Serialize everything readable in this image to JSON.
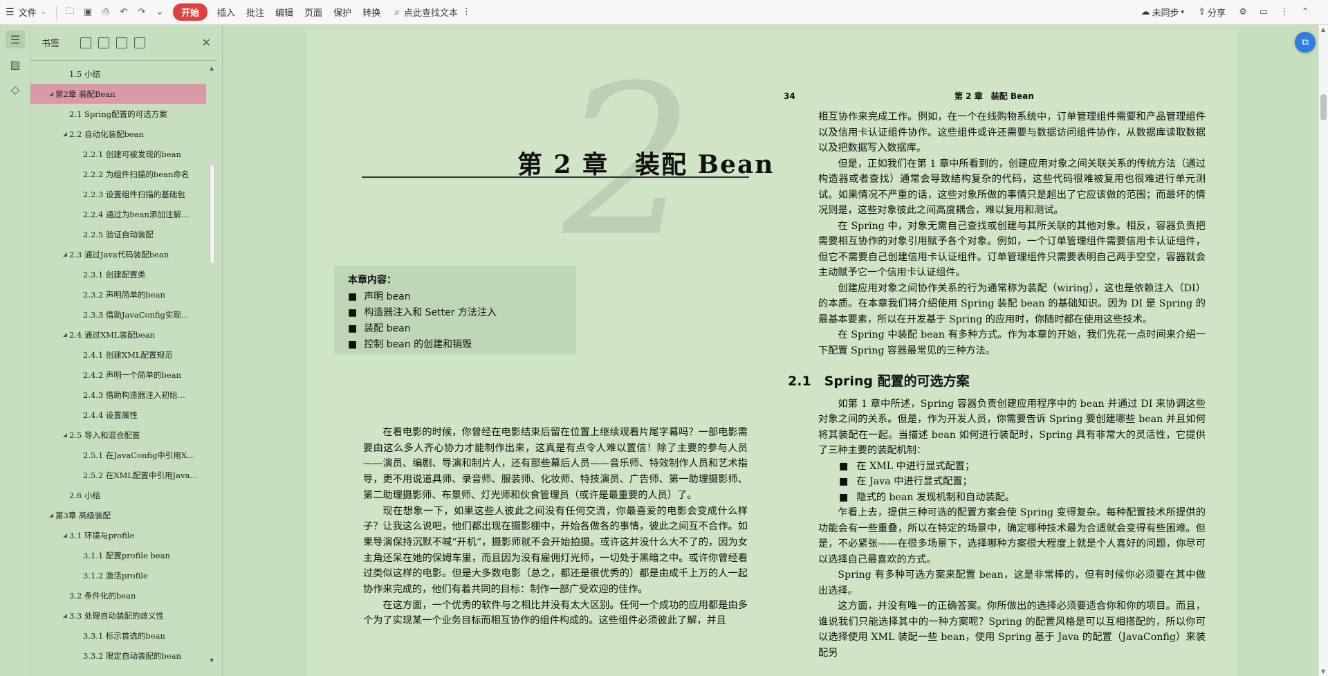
{
  "toolbar": {
    "file": "文件",
    "start": "开始",
    "tabs": [
      "插入",
      "批注",
      "编辑",
      "页面",
      "保护",
      "转换"
    ],
    "search_placeholder": "点此查找文本",
    "sync": "未同步",
    "share": "分享"
  },
  "sidebar": {
    "title": "书签",
    "items": [
      {
        "level": 2,
        "label": "1.5 小结",
        "toggle": ""
      },
      {
        "level": 1,
        "label": "第2章 装配Bean",
        "toggle": "◢",
        "selected": true
      },
      {
        "level": 2,
        "label": "2.1 Spring配置的可选方案",
        "toggle": ""
      },
      {
        "level": 2,
        "label": "2.2 自动化装配bean",
        "toggle": "◢"
      },
      {
        "level": 3,
        "label": "2.2.1 创建可被发现的bean",
        "toggle": ""
      },
      {
        "level": 3,
        "label": "2.2.2 为组件扫描的bean命名",
        "toggle": ""
      },
      {
        "level": 3,
        "label": "2.2.3 设置组件扫描的基础包",
        "toggle": ""
      },
      {
        "level": 3,
        "label": "2.2.4 通过为bean添加注解…",
        "toggle": ""
      },
      {
        "level": 3,
        "label": "2.2.5 验证自动装配",
        "toggle": ""
      },
      {
        "level": 2,
        "label": "2.3 通过Java代码装配bean",
        "toggle": "◢"
      },
      {
        "level": 3,
        "label": "2.3.1 创建配置类",
        "toggle": ""
      },
      {
        "level": 3,
        "label": "2.3.2 声明简单的bean",
        "toggle": ""
      },
      {
        "level": 3,
        "label": "2.3.3 借助JavaConfig实现…",
        "toggle": ""
      },
      {
        "level": 2,
        "label": "2.4 通过XML装配bean",
        "toggle": "◢"
      },
      {
        "level": 3,
        "label": "2.4.1 创建XML配置规范",
        "toggle": ""
      },
      {
        "level": 3,
        "label": "2.4.2 声明一个简单的bean",
        "toggle": ""
      },
      {
        "level": 3,
        "label": "2.4.3 借助构造器注入初始…",
        "toggle": ""
      },
      {
        "level": 3,
        "label": "2.4.4 设置属性",
        "toggle": ""
      },
      {
        "level": 2,
        "label": "2.5 导入和混合配置",
        "toggle": "◢"
      },
      {
        "level": 3,
        "label": "2.5.1 在JavaConfig中引用X…",
        "toggle": ""
      },
      {
        "level": 3,
        "label": "2.5.2 在XML配置中引用Java…",
        "toggle": ""
      },
      {
        "level": 2,
        "label": "2.6 小结",
        "toggle": ""
      },
      {
        "level": 1,
        "label": "第3章 高级装配",
        "toggle": "◢"
      },
      {
        "level": 2,
        "label": "3.1 环境与profile",
        "toggle": "◢"
      },
      {
        "level": 3,
        "label": "3.1.1 配置profile bean",
        "toggle": ""
      },
      {
        "level": 3,
        "label": "3.1.2 激活profile",
        "toggle": ""
      },
      {
        "level": 2,
        "label": "3.2 条件化的bean",
        "toggle": ""
      },
      {
        "level": 2,
        "label": "3.3 处理自动装配的歧义性",
        "toggle": "◢"
      },
      {
        "level": 3,
        "label": "3.3.1 标示首选的bean",
        "toggle": ""
      },
      {
        "level": 3,
        "label": "3.3.2 限定自动装配的bean",
        "toggle": ""
      }
    ]
  },
  "page_left": {
    "big_numeral": "2",
    "chapter_title": "第 2 章　装配 Bean",
    "contents_title": "本章内容：",
    "contents": [
      "声明 bean",
      "构造器注入和 Setter 方法注入",
      "装配 bean",
      "控制 bean 的创建和销毁"
    ],
    "paragraphs": [
      "在看电影的时候，你曾经在电影结束后留在位置上继续观看片尾字幕吗？一部电影需要由这么多人齐心协力才能制作出来，这真是有点令人难以置信！除了主要的参与人员——演员、编剧、导演和制片人，还有那些幕后人员——音乐师、特效制作人员和艺术指导，更不用说道具师、录音师、服装师、化妆师、特技演员、广告师、第一助理摄影师、第二助理摄影师、布景师、灯光师和伙食管理员（或许是最重要的人员）了。",
      "现在想象一下，如果这些人彼此之间没有任何交流，你最喜爱的电影会变成什么样子？让我这么说吧，他们都出现在摄影棚中，开始各做各的事情，彼此之间互不合作。如果导演保持沉默不喊“开机”，摄影师就不会开始拍摄。或许这并没什么大不了的，因为女主角还呆在她的保姆车里，而且因为没有雇佣灯光师，一切处于黑暗之中。或许你曾经看过类似这样的电影。但是大多数电影（总之，都还是很优秀的）都是由成千上万的人一起协作来完成的，他们有着共同的目标：制作一部广受欢迎的佳作。",
      "在这方面，一个优秀的软件与之相比并没有太大区别。任何一个成功的应用都是由多个为了实现某一个业务目标而相互协作的组件构成的。这些组件必须彼此了解，并且"
    ]
  },
  "page_right": {
    "page_number": "34",
    "running_head": "第 2 章　装配 Bean",
    "p1": [
      "相互协作来完成工作。例如，在一个在线购物系统中，订单管理组件需要和产品管理组件以及信用卡认证组件协作。这些组件或许还需要与数据访问组件协作，从数据库读取数据以及把数据写入数据库。",
      "但是，正如我们在第 1 章中所看到的，创建应用对象之间关联关系的传统方法（通过构造器或者查找）通常会导致结构复杂的代码，这些代码很难被复用也很难进行单元测试。如果情况不严重的话，这些对象所做的事情只是超出了它应该做的范围；而最坏的情况则是，这些对象彼此之间高度耦合，难以复用和测试。",
      "在 Spring 中，对象无需自己查找或创建与其所关联的其他对象。相反，容器负责把需要相互协作的对象引用赋予各个对象。例如，一个订单管理组件需要信用卡认证组件，但它不需要自己创建信用卡认证组件。订单管理组件只需要表明自己两手空空，容器就会主动赋予它一个信用卡认证组件。",
      "创建应用对象之间协作关系的行为通常称为装配（wiring），这也是依赖注入（DI）的本质。在本章我们将介绍使用 Spring 装配 bean 的基础知识。因为 DI 是 Spring 的最基本要素，所以在开发基于 Spring 的应用时，你随时都在使用这些技术。",
      "在 Spring 中装配 bean 有多种方式。作为本章的开始，我们先花一点时间来介绍一下配置 Spring 容器最常见的三种方法。"
    ],
    "section_heading": "2.1　Spring 配置的可选方案",
    "p2": "如第 1 章中所述，Spring 容器负责创建应用程序中的 bean 并通过 DI 来协调这些对象之间的关系。但是，作为开发人员，你需要告诉 Spring 要创建哪些 bean 并且如何将其装配在一起。当描述 bean 如何进行装配时，Spring 具有非常大的灵活性，它提供了三种主要的装配机制：",
    "bullets": [
      "在 XML 中进行显式配置；",
      "在 Java 中进行显式配置；",
      "隐式的 bean 发现机制和自动装配。"
    ],
    "p3": [
      "乍看上去，提供三种可选的配置方案会使 Spring 变得复杂。每种配置技术所提供的功能会有一些重叠，所以在特定的场景中，确定哪种技术最为合适就会变得有些困难。但是，不必紧张——在很多场景下，选择哪种方案很大程度上就是个人喜好的问题，你尽可以选择自己最喜欢的方式。",
      "Spring 有多种可选方案来配置 bean，这是非常棒的，但有时候你必须要在其中做出选择。",
      "这方面，并没有唯一的正确答案。你所做出的选择必须要适合你和你的项目。而且，谁说我们只能选择其中的一种方案呢？Spring 的配置风格是可以互相搭配的，所以你可以选择使用 XML 装配一些 bean，使用 Spring 基于 Java 的配置（JavaConfig）来装配另"
    ]
  }
}
